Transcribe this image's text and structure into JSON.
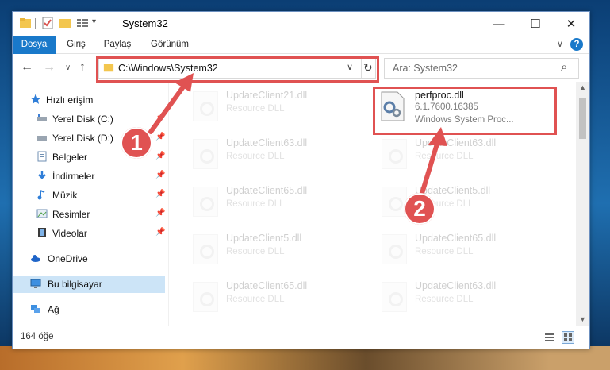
{
  "window": {
    "title": "System32",
    "controls": {
      "minimize": "—",
      "maximize": "☐",
      "close": "✕"
    }
  },
  "ribbon": {
    "tabs": [
      "Dosya",
      "Giriş",
      "Paylaş",
      "Görünüm"
    ],
    "expand": "∨",
    "help": "?"
  },
  "address": {
    "path": "C:\\Windows\\System32",
    "dropdown": "∨",
    "refresh": "↻"
  },
  "search": {
    "placeholder": "Ara: System32",
    "icon": "⌕"
  },
  "nav": {
    "back": "←",
    "forward": "→",
    "recent": "∨",
    "up": "↑",
    "items": [
      {
        "label": "Hızlı erişim",
        "icon": "star-icon"
      },
      {
        "label": "Yerel Disk (C:)",
        "icon": "drive-icon",
        "pinned": true
      },
      {
        "label": "Yerel Disk (D:)",
        "icon": "drive-icon",
        "pinned": true
      },
      {
        "label": "Belgeler",
        "icon": "documents-icon",
        "pinned": true
      },
      {
        "label": "İndirmeler",
        "icon": "download-icon",
        "pinned": true
      },
      {
        "label": "Müzik",
        "icon": "music-icon",
        "pinned": true
      },
      {
        "label": "Resimler",
        "icon": "pictures-icon",
        "pinned": true
      },
      {
        "label": "Videolar",
        "icon": "videos-icon",
        "pinned": true
      },
      {
        "label": "OneDrive",
        "icon": "cloud-icon"
      },
      {
        "label": "Bu bilgisayar",
        "icon": "computer-icon",
        "selected": true
      },
      {
        "label": "Ağ",
        "icon": "network-icon"
      }
    ]
  },
  "files": [
    {
      "name": "UpdateClient21.dll",
      "type": "Resource DLL"
    },
    {
      "name": "perfproc.dll",
      "version": "6.1.7600.16385",
      "type": "Windows System Proc..."
    },
    {
      "name": "UpdateClient63.dll",
      "type": "Resource DLL"
    },
    {
      "name": "UpdateClient63.dll",
      "type": "Resource DLL"
    },
    {
      "name": "UpdateClient65.dll",
      "type": "Resource DLL"
    },
    {
      "name": "UpdateClient5.dll",
      "type": "Resource DLL"
    },
    {
      "name": "UpdateClient5.dll",
      "type": "Resource DLL"
    },
    {
      "name": "UpdateClient65.dll",
      "type": "Resource DLL"
    },
    {
      "name": "UpdateClient65.dll",
      "type": "Resource DLL"
    },
    {
      "name": "UpdateClient63.dll",
      "type": "Resource DLL"
    }
  ],
  "status": {
    "count": "164 öğe"
  },
  "annotations": {
    "step1": "1",
    "step2": "2",
    "color": "#e05252"
  }
}
